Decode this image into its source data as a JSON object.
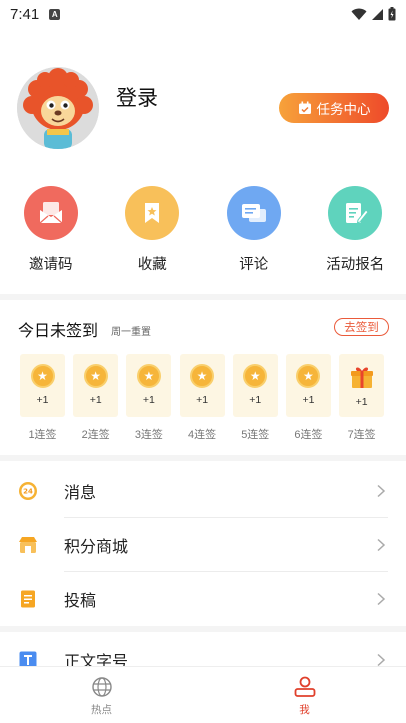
{
  "status": {
    "time": "7:41",
    "notif": "A"
  },
  "profile": {
    "login_label": "登录",
    "task_label": "任务中心"
  },
  "quick": [
    {
      "label": "邀请码",
      "icon": "invite-mail-icon",
      "color": "#f06a5e"
    },
    {
      "label": "收藏",
      "icon": "bookmark-icon",
      "color": "#f8c05a"
    },
    {
      "label": "评论",
      "icon": "comment-icon",
      "color": "#6fa8f2"
    },
    {
      "label": "活动报名",
      "icon": "signup-form-icon",
      "color": "#5fd3bd"
    }
  ],
  "signin": {
    "title": "今日未签到",
    "subtitle": "周一重置",
    "go_label": "去签到",
    "days": [
      {
        "plus": "+1",
        "label": "1连签",
        "icon": "coin-icon"
      },
      {
        "plus": "+1",
        "label": "2连签",
        "icon": "coin-icon"
      },
      {
        "plus": "+1",
        "label": "3连签",
        "icon": "coin-icon"
      },
      {
        "plus": "+1",
        "label": "4连签",
        "icon": "coin-icon"
      },
      {
        "plus": "+1",
        "label": "5连签",
        "icon": "coin-icon"
      },
      {
        "plus": "+1",
        "label": "6连签",
        "icon": "coin-icon"
      },
      {
        "plus": "+1",
        "label": "7连签",
        "icon": "gift-icon"
      }
    ]
  },
  "menu": [
    {
      "label": "消息",
      "icon": "message-24-icon"
    },
    {
      "label": "积分商城",
      "icon": "points-mall-icon"
    },
    {
      "label": "投稿",
      "icon": "contribute-doc-icon"
    },
    {
      "label": "正文字号",
      "icon": "font-size-icon"
    }
  ],
  "tabs": [
    {
      "label": "热点",
      "icon": "globe-icon",
      "active": false
    },
    {
      "label": "我",
      "icon": "person-icon",
      "active": true
    }
  ],
  "colors": {
    "accent": "#e0402c",
    "inactive": "#888888"
  }
}
